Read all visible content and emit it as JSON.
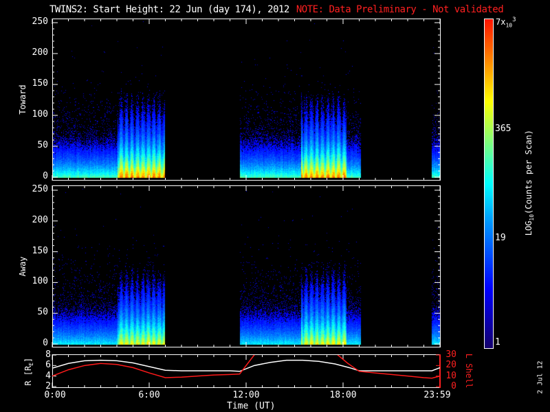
{
  "title": {
    "main": "TWINS2: Start Height: 22 Jun (day 174), 2012",
    "note": "NOTE: Data Preliminary - Not validated",
    "note_color": "#ff2020"
  },
  "chart_data": [
    {
      "type": "heatmap",
      "name": "Toward",
      "ylabel": "Toward",
      "ylim": [
        0,
        255
      ],
      "yticks": [
        "0",
        "50",
        "100",
        "150",
        "200",
        "250"
      ],
      "xlim_hours": [
        0,
        24
      ],
      "active_intervals_hours": [
        [
          0.0,
          6.95
        ],
        [
          11.6,
          19.1
        ],
        [
          23.5,
          24.0
        ]
      ],
      "burst_intervals_hours": [
        [
          4.0,
          6.95
        ],
        [
          15.4,
          18.2
        ]
      ],
      "intensity_scale": 1.0
    },
    {
      "type": "heatmap",
      "name": "Away",
      "ylabel": "Away",
      "ylim": [
        0,
        255
      ],
      "yticks": [
        "0",
        "50",
        "100",
        "150",
        "200",
        "250"
      ],
      "xlim_hours": [
        0,
        24
      ],
      "active_intervals_hours": [
        [
          0.0,
          6.95
        ],
        [
          11.6,
          19.1
        ],
        [
          23.5,
          24.0
        ]
      ],
      "burst_intervals_hours": [
        [
          4.0,
          6.95
        ],
        [
          15.4,
          18.2
        ]
      ],
      "intensity_scale": 0.85
    },
    {
      "type": "line",
      "ylabel_left": "R [R",
      "ylabel_left_sub": "E",
      "ylabel_left_end": "]",
      "ylabel_right": "L Shell",
      "ylim_left": [
        2,
        8
      ],
      "ylim_right": [
        0,
        30
      ],
      "yticks_left": [
        "2",
        "4",
        "6",
        "8"
      ],
      "yticks_right": [
        "0",
        "10",
        "20",
        "30"
      ],
      "xlabel": "Time (UT)",
      "xticks": [
        "0:00",
        "6:00",
        "12:00",
        "18:00",
        "23:59"
      ],
      "series": [
        {
          "name": "R",
          "color": "#ffffff",
          "x": [
            0,
            1,
            2,
            3,
            4,
            5,
            6,
            7,
            8,
            9,
            10,
            11,
            11.6,
            12.5,
            13.5,
            14.5,
            15.5,
            16.5,
            17.5,
            18.5,
            19.0,
            20,
            21,
            22,
            23,
            23.5,
            24
          ],
          "y": [
            5.5,
            6.4,
            6.9,
            7.0,
            6.9,
            6.5,
            5.8,
            5.1,
            5.0,
            5.0,
            5.0,
            5.0,
            4.9,
            6.0,
            6.6,
            7.0,
            7.0,
            6.8,
            6.3,
            5.5,
            5.0,
            5.0,
            5.0,
            5.0,
            5.0,
            5.0,
            5.6
          ]
        },
        {
          "name": "L Shell",
          "color": "#ff1a1a",
          "segments": [
            {
              "x": [
                0,
                1,
                2,
                3,
                4,
                5,
                6,
                7,
                8,
                9,
                10,
                11,
                11.6,
                12.55
              ],
              "y": [
                10,
                16,
                20,
                22,
                21,
                18,
                13,
                8.5,
                9,
                10,
                11,
                11.5,
                12,
                31
              ]
            },
            {
              "x": [
                17.6,
                18.3,
                19.0,
                20,
                21,
                22,
                23,
                23.5,
                24
              ],
              "y": [
                31,
                22,
                14.5,
                13,
                11.5,
                10,
                8.5,
                8,
                10
              ]
            }
          ]
        }
      ]
    }
  ],
  "colorbar": {
    "label": "LOG",
    "label_sub": "10",
    "label_rest": "(Counts per Scan)",
    "ticks": [
      "1",
      "19",
      "365"
    ],
    "top_label": "7x",
    "top_label_sub": "10",
    "top_label_sup": "3",
    "range_counts": [
      1,
      7000
    ]
  },
  "date_stamp": "2 Jul 12"
}
